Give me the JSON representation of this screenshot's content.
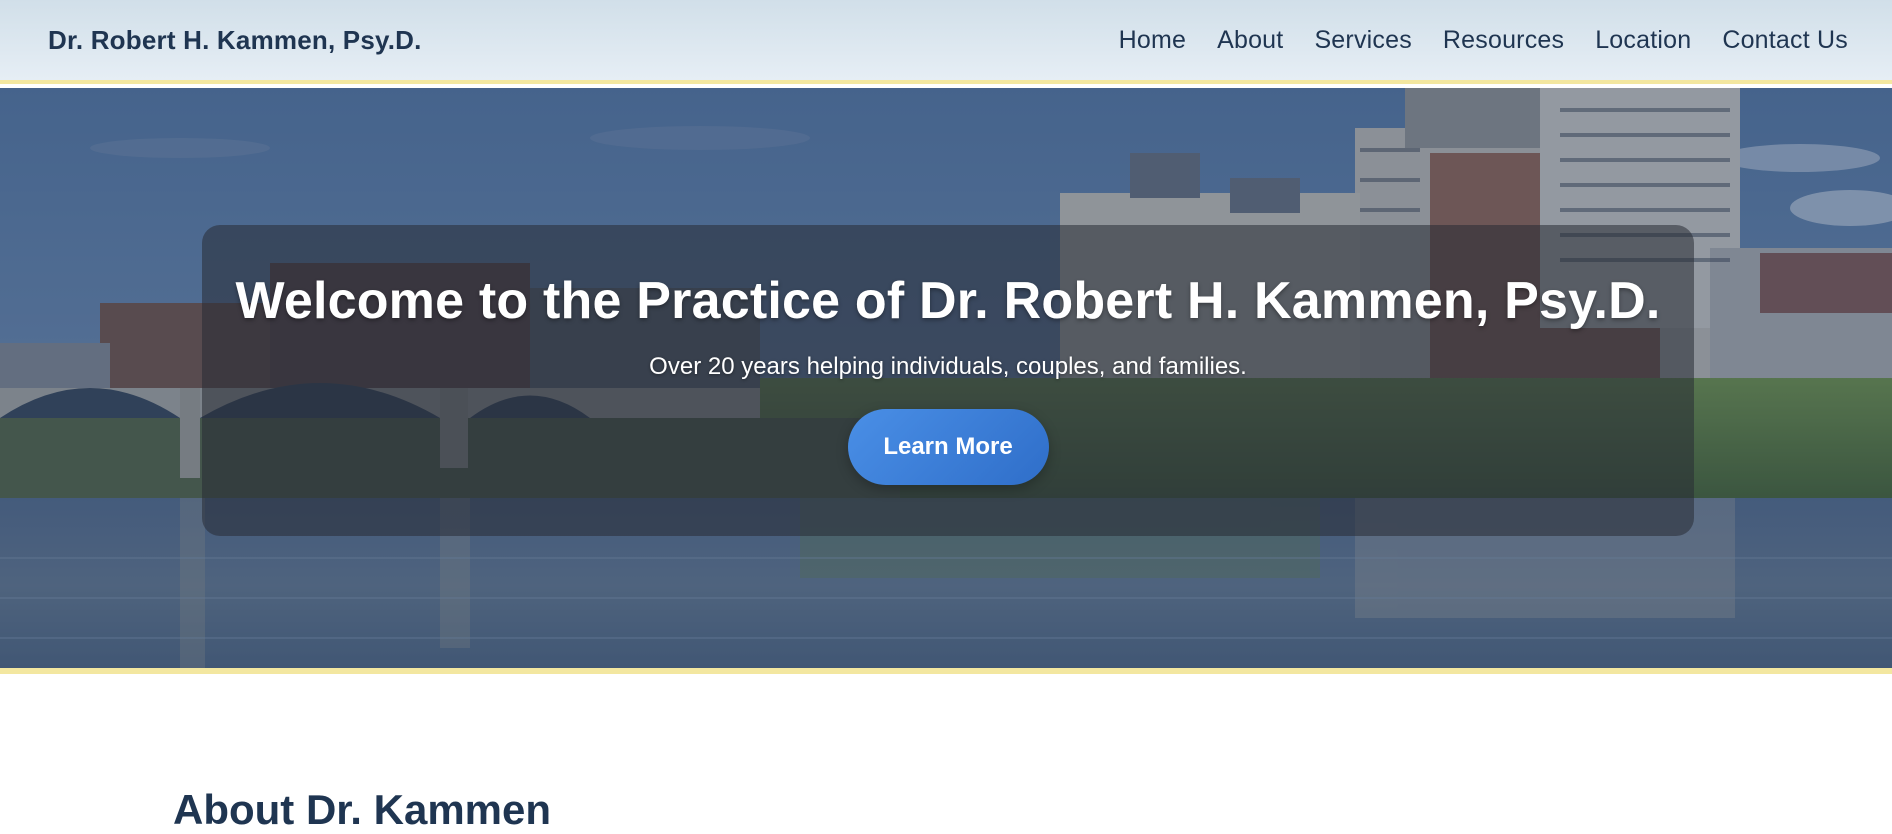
{
  "header": {
    "brand": "Dr. Robert H. Kammen, Psy.D.",
    "nav": [
      "Home",
      "About",
      "Services",
      "Resources",
      "Location",
      "Contact Us"
    ]
  },
  "hero": {
    "title": "Welcome to the Practice of Dr. Robert H. Kammen, Psy.D.",
    "subtitle": "Over 20 years helping individuals, couples, and families.",
    "cta_label": "Learn More",
    "background": "city-riverfront-skyline-image"
  },
  "about": {
    "heading": "About Dr. Kammen"
  },
  "colors": {
    "brand_text": "#1f3551",
    "accent_border": "#f3e7a0",
    "cta_blue": "#3a7bd5"
  }
}
